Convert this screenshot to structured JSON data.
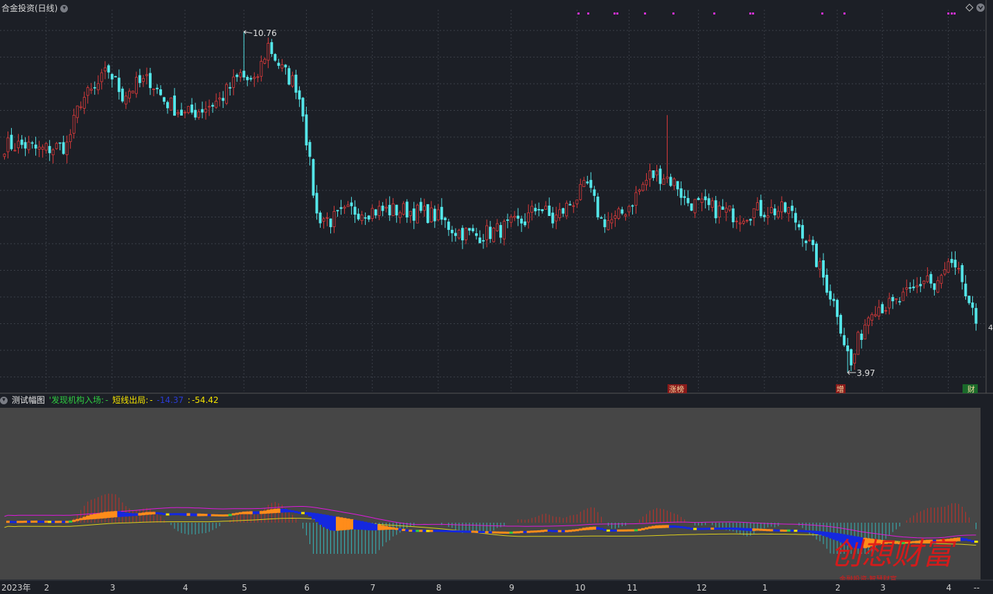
{
  "header": {
    "title": "合金投资(日线)",
    "high_label": "10.76",
    "low_label": "3.97",
    "right_edge_label": "4",
    "top_right_icon": "diamond-icon"
  },
  "indicator": {
    "name": "测试幅图",
    "items": [
      {
        "label": "'发现机构入场:",
        "value": "-",
        "color": "#2ecc40"
      },
      {
        "label": "短线出局:",
        "value": "-",
        "color": "#f5e400"
      },
      {
        "label": "",
        "value": "-14.37",
        "color": "#2a3cd6"
      },
      {
        "label": ":",
        "value": "-54.42",
        "color": "#f5e400"
      }
    ]
  },
  "events": [
    {
      "label": "涨榜",
      "color": "#f5d9a0",
      "bg": "#8a1a1a"
    },
    {
      "label": "增",
      "color": "#f5d9a0",
      "bg": "#8a1a1a"
    },
    {
      "label": "财",
      "color": "#f5d9a0",
      "bg": "#1a6a2a"
    }
  ],
  "watermark": {
    "text": "创想财富",
    "sub": "金融投资·智慧财富"
  },
  "x_axis": {
    "year_label": "2023年",
    "months": [
      "2",
      "3",
      "4",
      "5",
      "6",
      "7",
      "8",
      "9",
      "10",
      "11",
      "12",
      "1",
      "2",
      "3",
      "4"
    ],
    "end_label": "--"
  },
  "chart_data": [
    {
      "type": "candlestick",
      "title": "合金投资(日线)",
      "ylim": [
        3.6,
        11.2
      ],
      "high": 10.76,
      "low": 3.97,
      "anchors": [
        [
          0,
          8.5
        ],
        [
          6,
          8.5
        ],
        [
          10,
          8.4
        ],
        [
          18,
          8.5
        ],
        [
          22,
          9.4
        ],
        [
          26,
          9.6
        ],
        [
          30,
          10.0
        ],
        [
          34,
          9.5
        ],
        [
          38,
          9.7
        ],
        [
          42,
          9.8
        ],
        [
          46,
          9.4
        ],
        [
          52,
          9.1
        ],
        [
          56,
          9.2
        ],
        [
          62,
          9.4
        ],
        [
          68,
          9.9
        ],
        [
          72,
          9.7
        ],
        [
          76,
          10.5
        ],
        [
          80,
          10.0
        ],
        [
          84,
          9.7
        ],
        [
          86,
          9.2
        ],
        [
          88,
          8.1
        ],
        [
          90,
          7.1
        ],
        [
          94,
          7.0
        ],
        [
          100,
          7.2
        ],
        [
          110,
          7.2
        ],
        [
          116,
          7.2
        ],
        [
          124,
          7.1
        ],
        [
          130,
          6.8
        ],
        [
          136,
          6.7
        ],
        [
          142,
          6.8
        ],
        [
          150,
          7.0
        ],
        [
          154,
          7.3
        ],
        [
          158,
          7.0
        ],
        [
          164,
          7.4
        ],
        [
          168,
          7.7
        ],
        [
          172,
          7.0
        ],
        [
          176,
          7.0
        ],
        [
          180,
          7.3
        ],
        [
          186,
          7.9
        ],
        [
          190,
          7.9
        ],
        [
          194,
          7.7
        ],
        [
          196,
          7.4
        ],
        [
          200,
          7.3
        ],
        [
          206,
          7.2
        ],
        [
          212,
          7.1
        ],
        [
          216,
          7.2
        ],
        [
          222,
          7.2
        ],
        [
          226,
          7.2
        ],
        [
          230,
          6.8
        ],
        [
          234,
          6.2
        ],
        [
          240,
          5.2
        ],
        [
          242,
          4.6
        ],
        [
          244,
          4.1
        ],
        [
          246,
          4.6
        ],
        [
          250,
          5.3
        ],
        [
          256,
          5.3
        ],
        [
          262,
          5.6
        ],
        [
          266,
          5.9
        ],
        [
          268,
          5.6
        ],
        [
          272,
          6.1
        ],
        [
          276,
          5.8
        ],
        [
          278,
          5.2
        ],
        [
          280,
          5.0
        ]
      ],
      "spikes": [
        [
          69,
          10.76
        ],
        [
          191,
          9.1
        ],
        [
          243,
          3.97
        ]
      ],
      "bar_count": 281
    },
    {
      "type": "oscillator",
      "title": "测试幅图",
      "series": [
        {
          "name": "发现机构入场",
          "color": "#2ecc40"
        },
        {
          "name": "短线出局",
          "color": "#f5e400"
        }
      ],
      "latest": [
        -14.37,
        -54.42
      ],
      "ribbon_colors": {
        "up": "#ff8c1a",
        "down": "#1428e0",
        "turn_up": "#2ecc40",
        "turn_down": "#f5e400"
      },
      "histogram_colors": {
        "pos": "#c0322a",
        "neg": "#35b5b8"
      },
      "line_colors": {
        "slow": "#e01adf",
        "signal": "#e0d21a"
      }
    }
  ]
}
